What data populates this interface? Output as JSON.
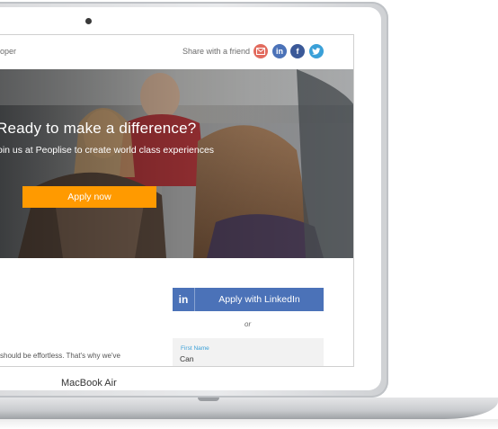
{
  "device": {
    "brand_label": "MacBook Air"
  },
  "header": {
    "logo_text": "oper",
    "share_label": "Share with a friend",
    "share_icons": [
      {
        "name": "email-share-icon",
        "glyph": "✉",
        "color": "#e26b5e"
      },
      {
        "name": "linkedin-share-icon",
        "glyph": "in",
        "color": "#4b72b8"
      },
      {
        "name": "facebook-share-icon",
        "glyph": "f",
        "color": "#3b5998"
      },
      {
        "name": "twitter-share-icon",
        "glyph": "t",
        "color": "#3aa0d8"
      }
    ]
  },
  "hero": {
    "title": "Ready to make a difference?",
    "subtitle": "oin us at Peoplise to create world class experiences",
    "cta_label": "Apply now",
    "cta_color": "#ff9a00"
  },
  "apply": {
    "linkedin_logo": "in",
    "linkedin_label": "Apply with LinkedIn",
    "linkedin_color": "#4b72b8",
    "or_text": "or",
    "body_text": "should be effortless. That's why we've"
  },
  "form": {
    "first_name_label": "First Name",
    "first_name_value": "Can"
  }
}
